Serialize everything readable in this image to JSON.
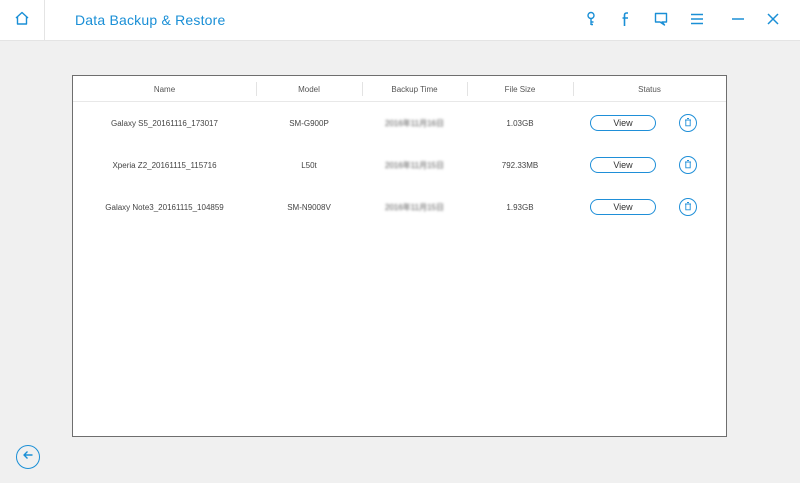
{
  "header": {
    "title": "Data Backup & Restore",
    "icons": [
      "home-icon",
      "key-icon",
      "facebook-icon",
      "feedback-icon",
      "menu-icon",
      "minimize-icon",
      "close-icon"
    ]
  },
  "table": {
    "columns": [
      "Name",
      "Model",
      "Backup Time",
      "File Size",
      "Status"
    ],
    "rows": [
      {
        "name": "Galaxy S5_20161116_173017",
        "model": "SM-G900P",
        "time": "2016年11月16日",
        "size": "1.03GB",
        "view": "View"
      },
      {
        "name": "Xperia Z2_20161115_115716",
        "model": "L50t",
        "time": "2016年11月15日",
        "size": "792.33MB",
        "view": "View"
      },
      {
        "name": "Galaxy Note3_20161115_104859",
        "model": "SM-N9008V",
        "time": "2016年11月15日",
        "size": "1.93GB",
        "view": "View"
      }
    ]
  },
  "footer": {
    "back_icon": "back-arrow-icon"
  },
  "colors": {
    "accent": "#1a8fd6",
    "background": "#f0f0f0",
    "panel_border": "#6e6e6e"
  }
}
